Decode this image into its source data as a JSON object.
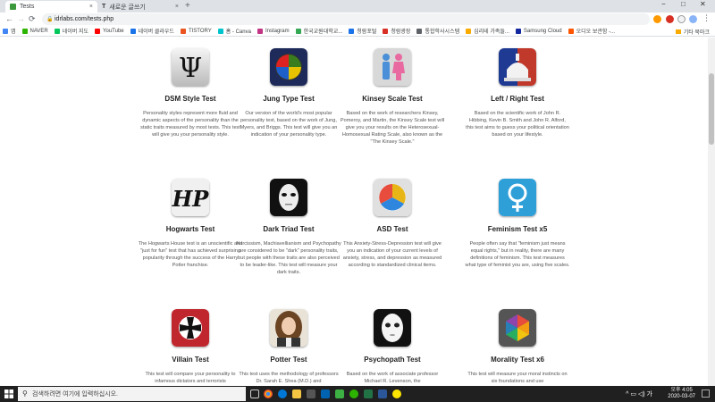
{
  "browser": {
    "tabs": [
      {
        "label": "Tests",
        "close": "×"
      },
      {
        "label": "새로운 글쓰기",
        "close": "×"
      }
    ],
    "new_tab": "+",
    "window_controls": {
      "minimize": "−",
      "maximize": "□",
      "close": "✕"
    },
    "nav": {
      "back": "←",
      "forward": "→",
      "reload": "⟳"
    },
    "url": "idrlabs.com/tests.php",
    "bookmarks": [
      {
        "label": "앱",
        "color": "#4285f4"
      },
      {
        "label": "NAVER",
        "color": "#2db400"
      },
      {
        "label": "네이버 지도",
        "color": "#03c75a"
      },
      {
        "label": "YouTube",
        "color": "#ff0000"
      },
      {
        "label": "네이버 클라우드",
        "color": "#1a73e8"
      },
      {
        "label": "TISTORY",
        "color": "#eb531f"
      },
      {
        "label": "홈 - Canva",
        "color": "#00c4cc"
      },
      {
        "label": "Instagram",
        "color": "#c13584"
      },
      {
        "label": "한국교원대학교...",
        "color": "#34a853"
      },
      {
        "label": "청람포털",
        "color": "#1a73e8"
      },
      {
        "label": "청람광장",
        "color": "#d93025"
      },
      {
        "label": "통합학사시스템",
        "color": "#5f6368"
      },
      {
        "label": "심리테 가족들...",
        "color": "#f9ab00"
      },
      {
        "label": "Samsung Cloud",
        "color": "#1428a0"
      },
      {
        "label": "오디오 보관함 -...",
        "color": "#ff5500"
      }
    ],
    "bookmarks_other": "기타 북마크"
  },
  "tests": [
    {
      "title": "DSM Style Test",
      "icon": "psi-icon",
      "desc": "Personality styles represent more fluid and dynamic aspects of the personality than the static traits measured by most tests. This test will give you your personality style."
    },
    {
      "title": "Jung Type Test",
      "icon": "four-color-wheel-icon",
      "desc": "Our version of the world's most popular personality test, based on the work of Jung, Myers, and Briggs. This test will give you an indication of your personality type."
    },
    {
      "title": "Kinsey Scale Test",
      "icon": "man-woman-icon",
      "desc": "Based on the work of researchers Kinsey, Pomeroy, and Martin, the Kinsey Scale test will give you your results on the Heterosexual-Homosexual Rating Scale, also known as the \"The Kinsey Scale.\""
    },
    {
      "title": "Left / Right Test",
      "icon": "capitol-dome-icon",
      "desc": "Based on the scientific work of John R. Hibbing, Kevin B. Smith and John R. Alford, this test aims to guess your political orientation based on your lifestyle."
    },
    {
      "title": "Hogwarts Test",
      "icon": "hp-logo-icon",
      "desc": "The Hogwarts House test is an unscientific and \"just for fun\" test that has achieved surprising popularity through the success of the Harry Potter franchise."
    },
    {
      "title": "Dark Triad Test",
      "icon": "mask-icon",
      "desc": "Narcissism, Machiavellianism and Psychopathy are considered to be \"dark\" personality traits, but people with these traits are also perceived to be leader-like. This test will measure your dark traits."
    },
    {
      "title": "ASD Test",
      "icon": "three-circles-icon",
      "desc": "This Anxiety-Stress-Depression test will give you an indication of your current levels of anxiety, stress, and depression as measured according to standardized clinical items."
    },
    {
      "title": "Feminism Test x5",
      "icon": "venus-icon",
      "desc": "People often say that \"feminism just means equal rights,\" but in reality, there are many definitions of feminism. This test measures what type of feminist you are, using five scales."
    },
    {
      "title": "Villain Test",
      "icon": "iron-cross-icon",
      "desc": "This test will compare your personality to infamous dictators and terrorists"
    },
    {
      "title": "Potter Test",
      "icon": "hermione-portrait-icon",
      "desc": "This test uses the methodology of professors Dr. Sarah E. Shea (M.D.) and"
    },
    {
      "title": "Psychopath Test",
      "icon": "white-mask-icon",
      "desc": "Based on the work of associate professor Michael R. Levenson, the"
    },
    {
      "title": "Morality Test x6",
      "icon": "hexagon-wheel-icon",
      "desc": "This test will measure your moral instincts on six foundations and use"
    }
  ],
  "taskbar": {
    "search_placeholder": "검색하려면 여기에 입력하십시오.",
    "tray_icons": "^ ▭ ◁) 가",
    "time": "오후 4:05",
    "date": "2020-03-07"
  }
}
